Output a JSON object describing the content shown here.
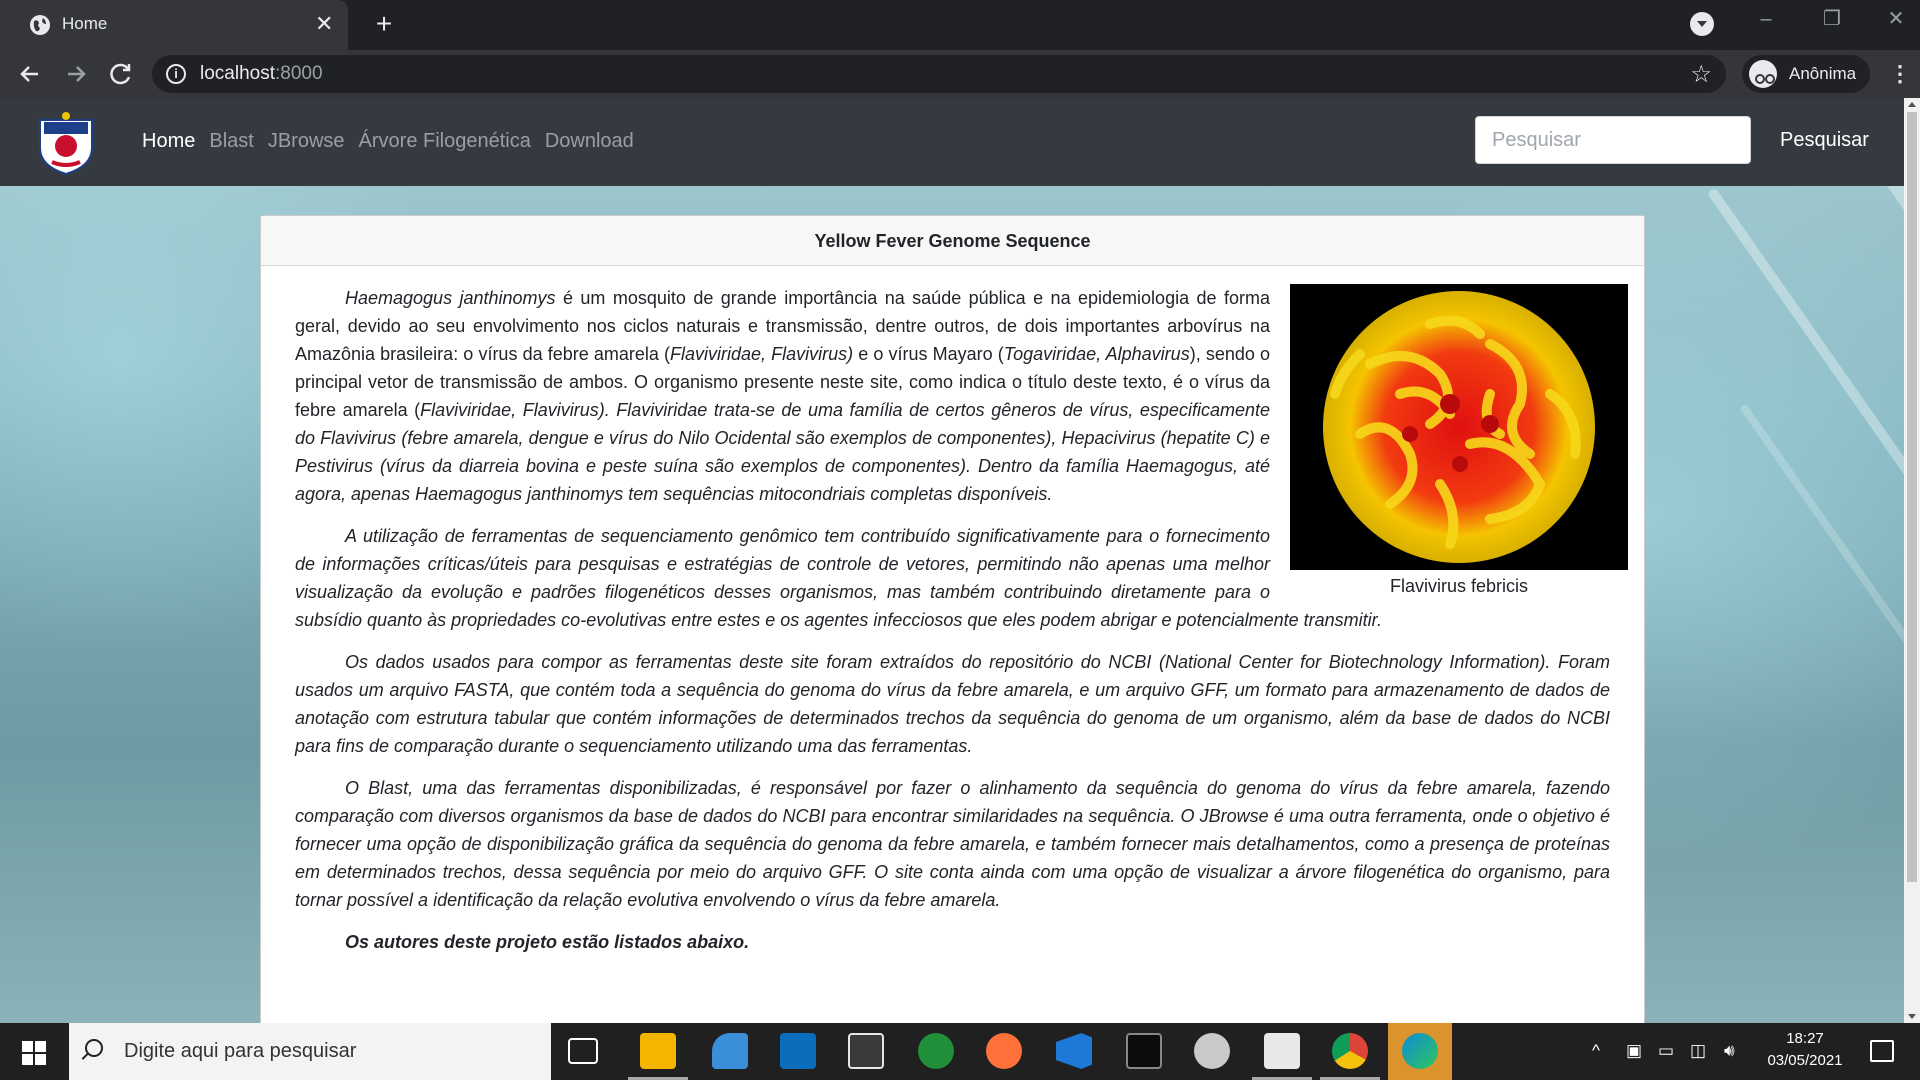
{
  "browser": {
    "tab_title": "Home",
    "tab_close": "✕",
    "new_tab": "+",
    "url_host": "localhost",
    "url_port": ":8000",
    "profile_label": "Anônima"
  },
  "site": {
    "nav": [
      {
        "label": "Home",
        "active": true
      },
      {
        "label": "Blast"
      },
      {
        "label": "JBrowse"
      },
      {
        "label": "Árvore Filogenética"
      },
      {
        "label": "Download"
      }
    ],
    "search_placeholder": "Pesquisar",
    "search_button": "Pesquisar"
  },
  "card": {
    "title": "Yellow Fever Genome Sequence",
    "image_caption": "Flavivirus febricis",
    "p1": {
      "a": "Haemagogus janthinomys",
      "b": " é um mosquito de grande importância na saúde pública e na epidemiologia de forma geral, devido ao seu envolvimento nos ciclos naturais e transmissão, dentre outros, de dois importantes arbovírus na Amazônia brasileira: o vírus da febre amarela (",
      "c": "Flaviviridae, Flavivirus)",
      "d": " e o vírus Mayaro (",
      "e": "Togaviridae, Alphavirus",
      "f": "), sendo o principal vetor de transmissão de ambos. O organismo presente neste site, como indica o título deste texto, é o vírus da febre amarela (",
      "g": "Flaviviridae, Flavivirus). Flaviviridae trata-se de uma família de certos gêneros de vírus, especificamente do Flavivirus (febre amarela, dengue e vírus do Nilo Ocidental são exemplos de componentes), Hepacivirus (hepatite C) e Pestivirus (vírus da diarreia bovina e peste suína são exemplos de componentes). Dentro da família Haemagogus, até agora, apenas Haemagogus janthinomys tem sequências mitocondriais completas disponíveis."
    },
    "p2": "A utilização de ferramentas de sequenciamento genômico tem contribuído significativamente para o fornecimento de informações críticas/úteis para pesquisas e estratégias de controle de vetores, permitindo não apenas uma melhor visualização da evolução e padrões filogenéticos desses organismos, mas também contribuindo diretamente para o subsídio quanto às propriedades co-evolutivas entre estes e os agentes infecciosos que eles podem abrigar e potencialmente transmitir.",
    "p3": "Os dados usados para compor as ferramentas deste site foram extraídos do repositório do NCBI (National Center for Biotechnology Information). Foram usados um arquivo FASTA, que contém toda a sequência do genoma do vírus da febre amarela, e um arquivo GFF, um formato para armazenamento de dados de anotação com estrutura tabular que contém informações de determinados trechos da sequência do genoma de um organismo, além da base de dados do NCBI para fins de comparação durante o sequenciamento utilizando uma das ferramentas.",
    "p4": "O Blast, uma das ferramentas disponibilizadas, é responsável por fazer o alinhamento da sequência do genoma do vírus da febre amarela, fazendo comparação com diversos organismos da base de dados do NCBI para encontrar similaridades na sequência. O JBrowse é uma outra ferramenta, onde o objetivo é fornecer uma opção de disponibilização gráfica da sequência do genoma da febre amarela, e também fornecer mais detalhamentos, como a presença de proteínas em determinados trechos, dessa sequência por meio do arquivo GFF. O site conta ainda com uma opção de visualizar a árvore filogenética do organismo, para tornar possível a identificação da relação evolutiva envolvendo o vírus da febre amarela.",
    "authors": "Os autores deste projeto estão listados abaixo."
  },
  "taskbar": {
    "search_placeholder": "Digite aqui para pesquisar",
    "time": "18:27",
    "date": "03/05/2021",
    "apps": [
      "task-view-icon",
      "file-explorer-icon",
      "photos-icon",
      "calculator-icon",
      "store-icon",
      "maps-icon",
      "firefox-icon",
      "vscode-icon",
      "terminal-icon",
      "disc-icon",
      "office-icon",
      "chrome-icon",
      "edge-icon"
    ]
  },
  "colors": {
    "navbar_bg": "#343a40",
    "chrome_bg": "#35363a",
    "taskbar_bg": "#202020"
  }
}
